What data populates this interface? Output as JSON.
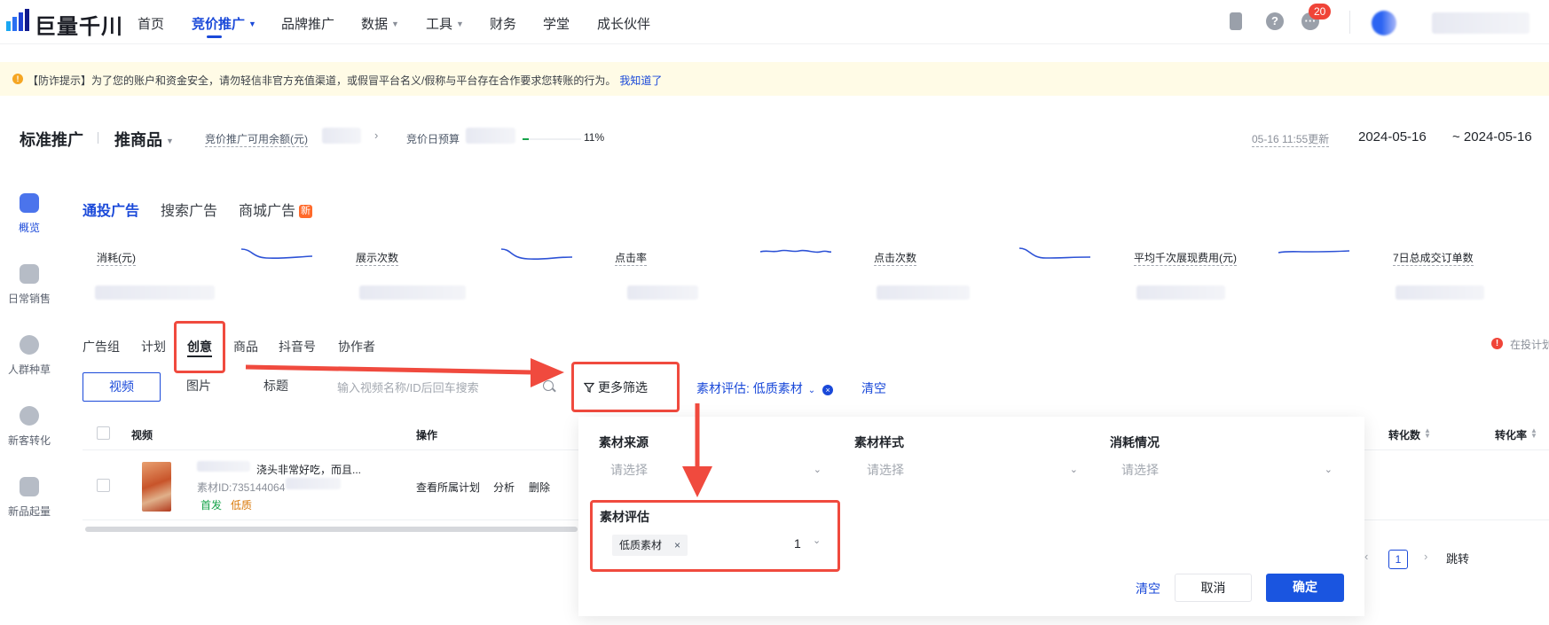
{
  "brand": {
    "name": "巨量千川"
  },
  "nav": {
    "items": [
      "首页",
      "竞价推广",
      "品牌推广",
      "数据",
      "工具",
      "财务",
      "学堂",
      "成长伙伴"
    ],
    "message_count": "20"
  },
  "notice": {
    "text": "【防诈提示】为了您的账户和资金安全，请勿轻信非官方充值渠道，或假冒平台名义/假称与平台存在合作要求您转账的行为。",
    "link": "我知道了"
  },
  "header": {
    "title": "标准推广",
    "subtitle": "推商品",
    "balance_label": "竞价推广可用余额(元)",
    "budget_label": "竞价日预算",
    "budget_pct": "11%",
    "updated": "05-16 11:55更新",
    "date_start": "2024-05-16",
    "date_end": "~ 2024-05-16"
  },
  "sidebar": [
    "概览",
    "日常销售",
    "人群种草",
    "新客转化",
    "新品起量"
  ],
  "channels": {
    "items": [
      "通投广告",
      "搜索广告",
      "商城广告"
    ],
    "new_badge": "新"
  },
  "metrics": [
    "消耗(元)",
    "展示次数",
    "点击率",
    "点击次数",
    "平均千次展现费用(元)",
    "7日总成交订单数"
  ],
  "subtabs": [
    "广告组",
    "计划",
    "创意",
    "商品",
    "抖音号",
    "协作者"
  ],
  "right_note": "在投计划",
  "media_tabs": [
    "视频",
    "图片",
    "标题"
  ],
  "search": {
    "placeholder": "输入视频名称/ID后回车搜索"
  },
  "filter": {
    "more": "更多筛选",
    "eval_tag": "素材评估: 低质素材",
    "clear": "清空"
  },
  "table": {
    "headers": {
      "video": "视频",
      "ops": "操作",
      "conv_count": "转化数",
      "conv_rate": "转化率"
    },
    "row": {
      "title": "浇头非常好吃，而且...",
      "material_id": "素材ID:735144064",
      "tag_first": "首发",
      "tag_quality": "低质",
      "ops": [
        "查看所属计划",
        "分析",
        "删除"
      ]
    }
  },
  "popup": {
    "source_label": "素材来源",
    "style_label": "素材样式",
    "spend_label": "消耗情况",
    "placeholder": "请选择",
    "eval_label": "素材评估",
    "eval_chip": "低质素材",
    "eval_count": "1",
    "clear": "清空",
    "cancel": "取消",
    "confirm": "确定"
  },
  "pager": {
    "page": "1",
    "jump": "跳转"
  },
  "colors": {
    "primary": "#1a49d9",
    "annotation": "#f04a3e",
    "notice_bg": "#fffbe6"
  }
}
